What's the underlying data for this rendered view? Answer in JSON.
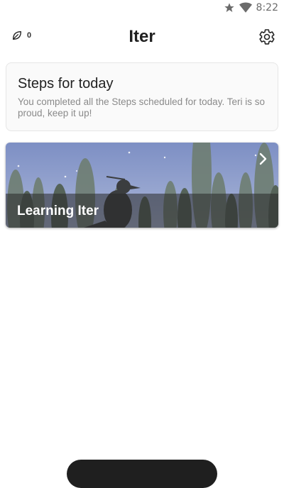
{
  "status_bar": {
    "time": "8:22",
    "icons": [
      "star-icon",
      "wifi-icon"
    ]
  },
  "app_bar": {
    "title": "Iter",
    "leaf_count": "0",
    "leaf_icon": "leaf-icon",
    "settings_icon": "gear-icon"
  },
  "steps_card": {
    "title": "Steps for today",
    "body": "You completed all the Steps scheduled for today. Teri is so proud, keep it up!"
  },
  "course_card": {
    "label": "Learning Iter",
    "chevron_icon": "chevron-right-icon"
  },
  "colors": {
    "sky_top": "#7d8fc4",
    "sky_bottom": "#a9b6d8",
    "tree": "#5a6a63",
    "band": "#2e2e2e"
  }
}
